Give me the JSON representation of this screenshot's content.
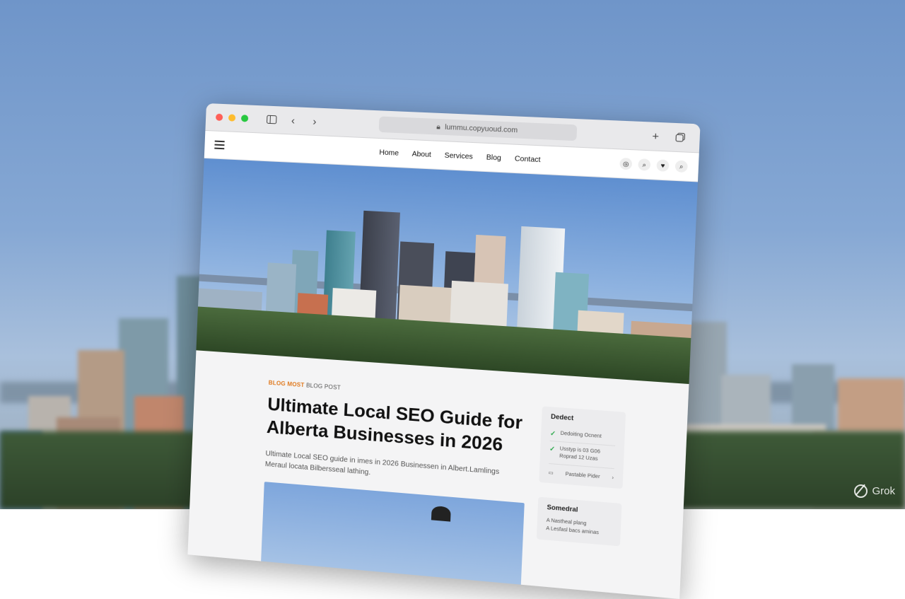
{
  "colors": {
    "accent": "#e07a1f",
    "check": "#2aa84a",
    "close": "#ff5f57",
    "minimize": "#febc2e",
    "zoom": "#28c840"
  },
  "browser": {
    "address": "lummu.copyuoud.com",
    "icons": [
      "sidebar-icon",
      "back-icon",
      "forward-icon",
      "new-tab-icon",
      "tabs-icon"
    ]
  },
  "site": {
    "nav": [
      "Home",
      "About",
      "Services",
      "Blog",
      "Contact"
    ]
  },
  "article": {
    "eyebrow_accent": "BLOG MOST",
    "eyebrow": "BLOG POST",
    "title": "Ultimate Local SEO Guide for Alberta Businesses in 2026",
    "excerpt": "Ultimate Local SEO guide in imes in 2026 Businessen in Albert.Lamlings Meraul locata Bilbersseal lathing."
  },
  "sidebar": {
    "card1": {
      "heading": "Dedect",
      "items": [
        "Dedoiting Ocnent",
        "Usstyp is 03 G06 Roprad 12 Uzas"
      ],
      "link": "Pastable Pider"
    },
    "card2": {
      "heading": "Somedral",
      "lines": [
        "A Nastheal plang",
        "A Lesfasl bacs aminas"
      ]
    }
  },
  "watermark": "Grok"
}
